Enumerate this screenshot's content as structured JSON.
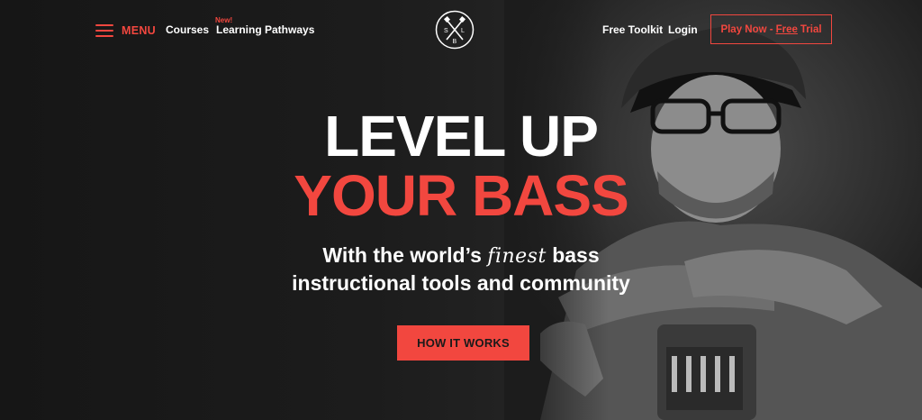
{
  "nav": {
    "menu_label": "MENU",
    "courses": "Courses",
    "new_badge": "New!",
    "learning_pathways": "Learning Pathways",
    "free_toolkit": "Free Toolkit",
    "login": "Login",
    "cta_prefix": "Play Now -",
    "cta_free": "Free",
    "cta_suffix": "Trial"
  },
  "logo": {
    "letters": [
      "S",
      "L",
      "B"
    ]
  },
  "hero": {
    "line1": "LEVEL UP",
    "line2": "YOUR BASS",
    "sub_part1": "With the world’s",
    "sub_finest": "finest",
    "sub_part2": "bass",
    "sub_line2": "instructional tools and community",
    "button": "HOW IT WORKS"
  },
  "colors": {
    "accent": "#f2473f",
    "background": "#1b1b1b",
    "text": "#ffffff"
  }
}
